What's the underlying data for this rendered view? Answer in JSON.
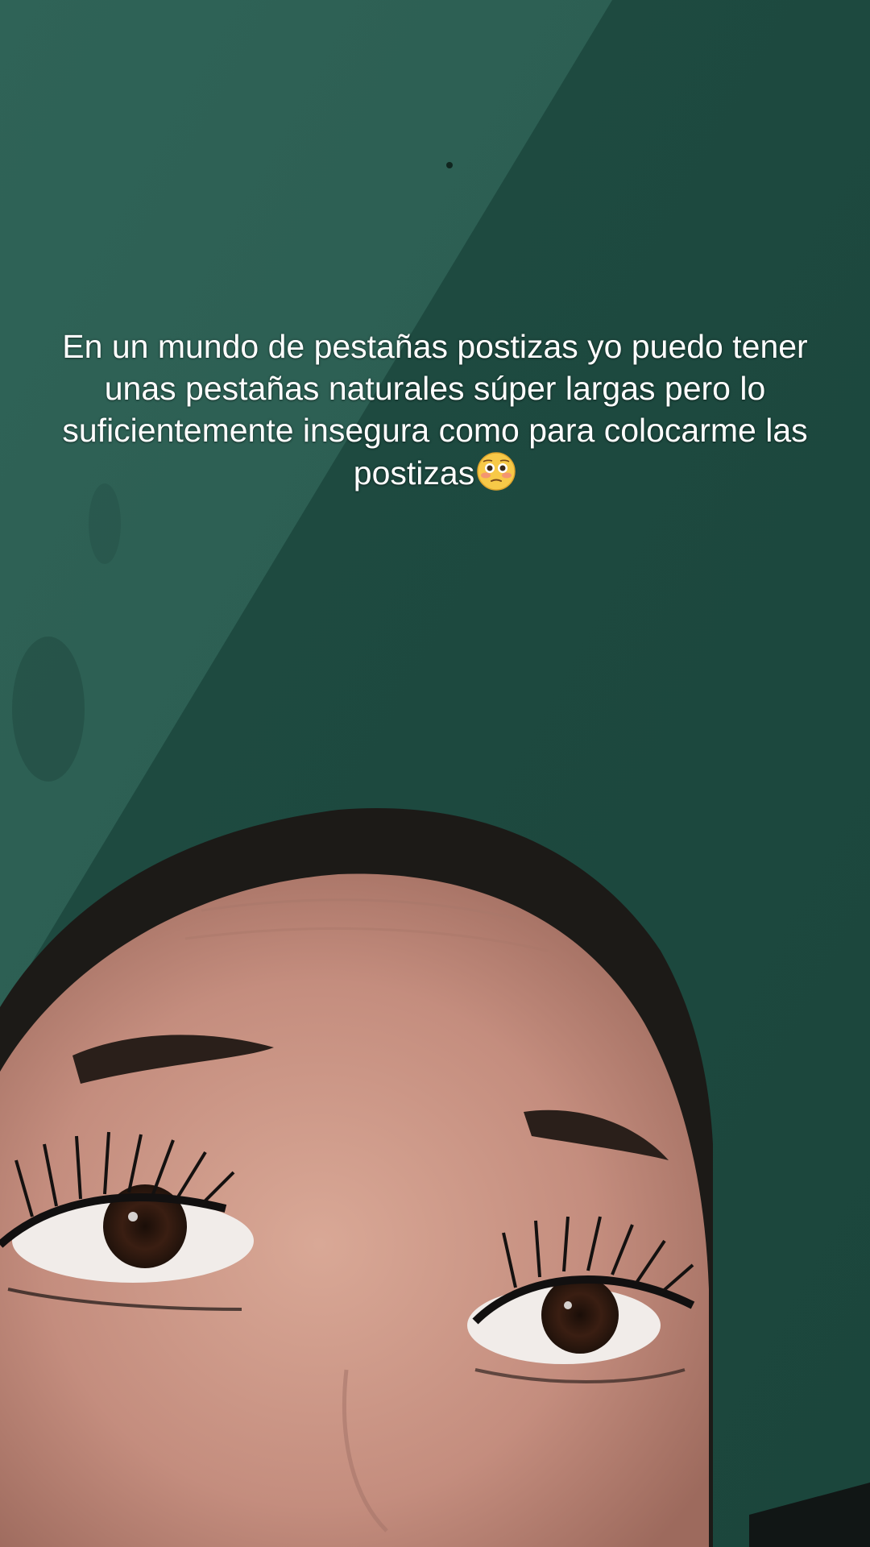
{
  "caption": {
    "text": "En un mundo de pestañas postizas yo puedo tener unas pestañas naturales súper largas pero lo suficientemente insegura como para colocarme las postizas",
    "emoji": "flushed-face-icon"
  },
  "colors": {
    "wall_light": "#2c5e52",
    "wall_dark": "#1e4b41",
    "hair": "#1c1a17",
    "skin": "#c48d7e",
    "caption_text": "#ffffff"
  }
}
